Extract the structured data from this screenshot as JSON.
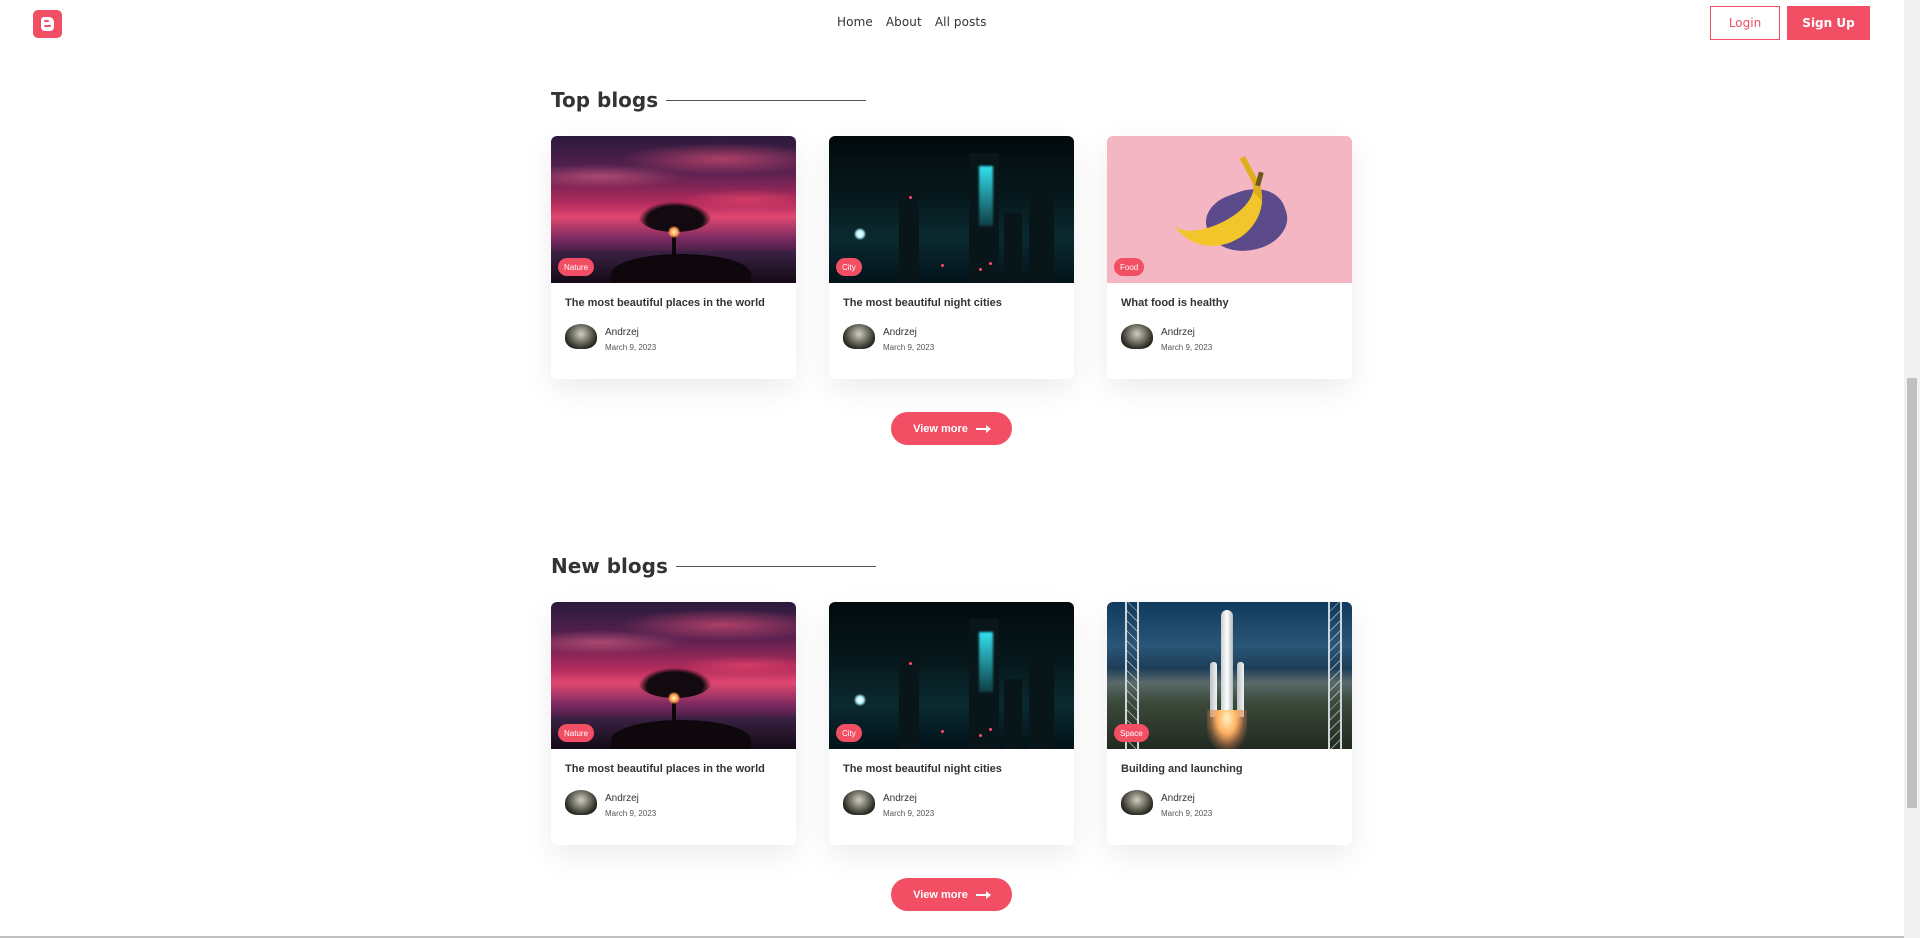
{
  "header": {
    "nav": [
      "Home",
      "About",
      "All posts"
    ],
    "login": "Login",
    "signup": "Sign Up"
  },
  "sections": [
    {
      "title": "Top blogs",
      "cards": [
        {
          "tag": "Nature",
          "title": "The most beautiful places in the world",
          "author": "Andrzej",
          "date": "March 9, 2023"
        },
        {
          "tag": "City",
          "title": "The most beautiful night cities",
          "author": "Andrzej",
          "date": "March 9, 2023"
        },
        {
          "tag": "Food",
          "title": "What food is healthy",
          "author": "Andrzej",
          "date": "March 9, 2023"
        }
      ],
      "button": "View more"
    },
    {
      "title": "New blogs",
      "cards": [
        {
          "tag": "Nature",
          "title": "The most beautiful places in the world",
          "author": "Andrzej",
          "date": "March 9, 2023"
        },
        {
          "tag": "City",
          "title": "The most beautiful night cities",
          "author": "Andrzej",
          "date": "March 9, 2023"
        },
        {
          "tag": "Space",
          "title": "Building and launching",
          "author": "Andrzej",
          "date": "March 9, 2023"
        }
      ],
      "button": "View more"
    }
  ],
  "colors": {
    "accent": "#f24e64"
  }
}
